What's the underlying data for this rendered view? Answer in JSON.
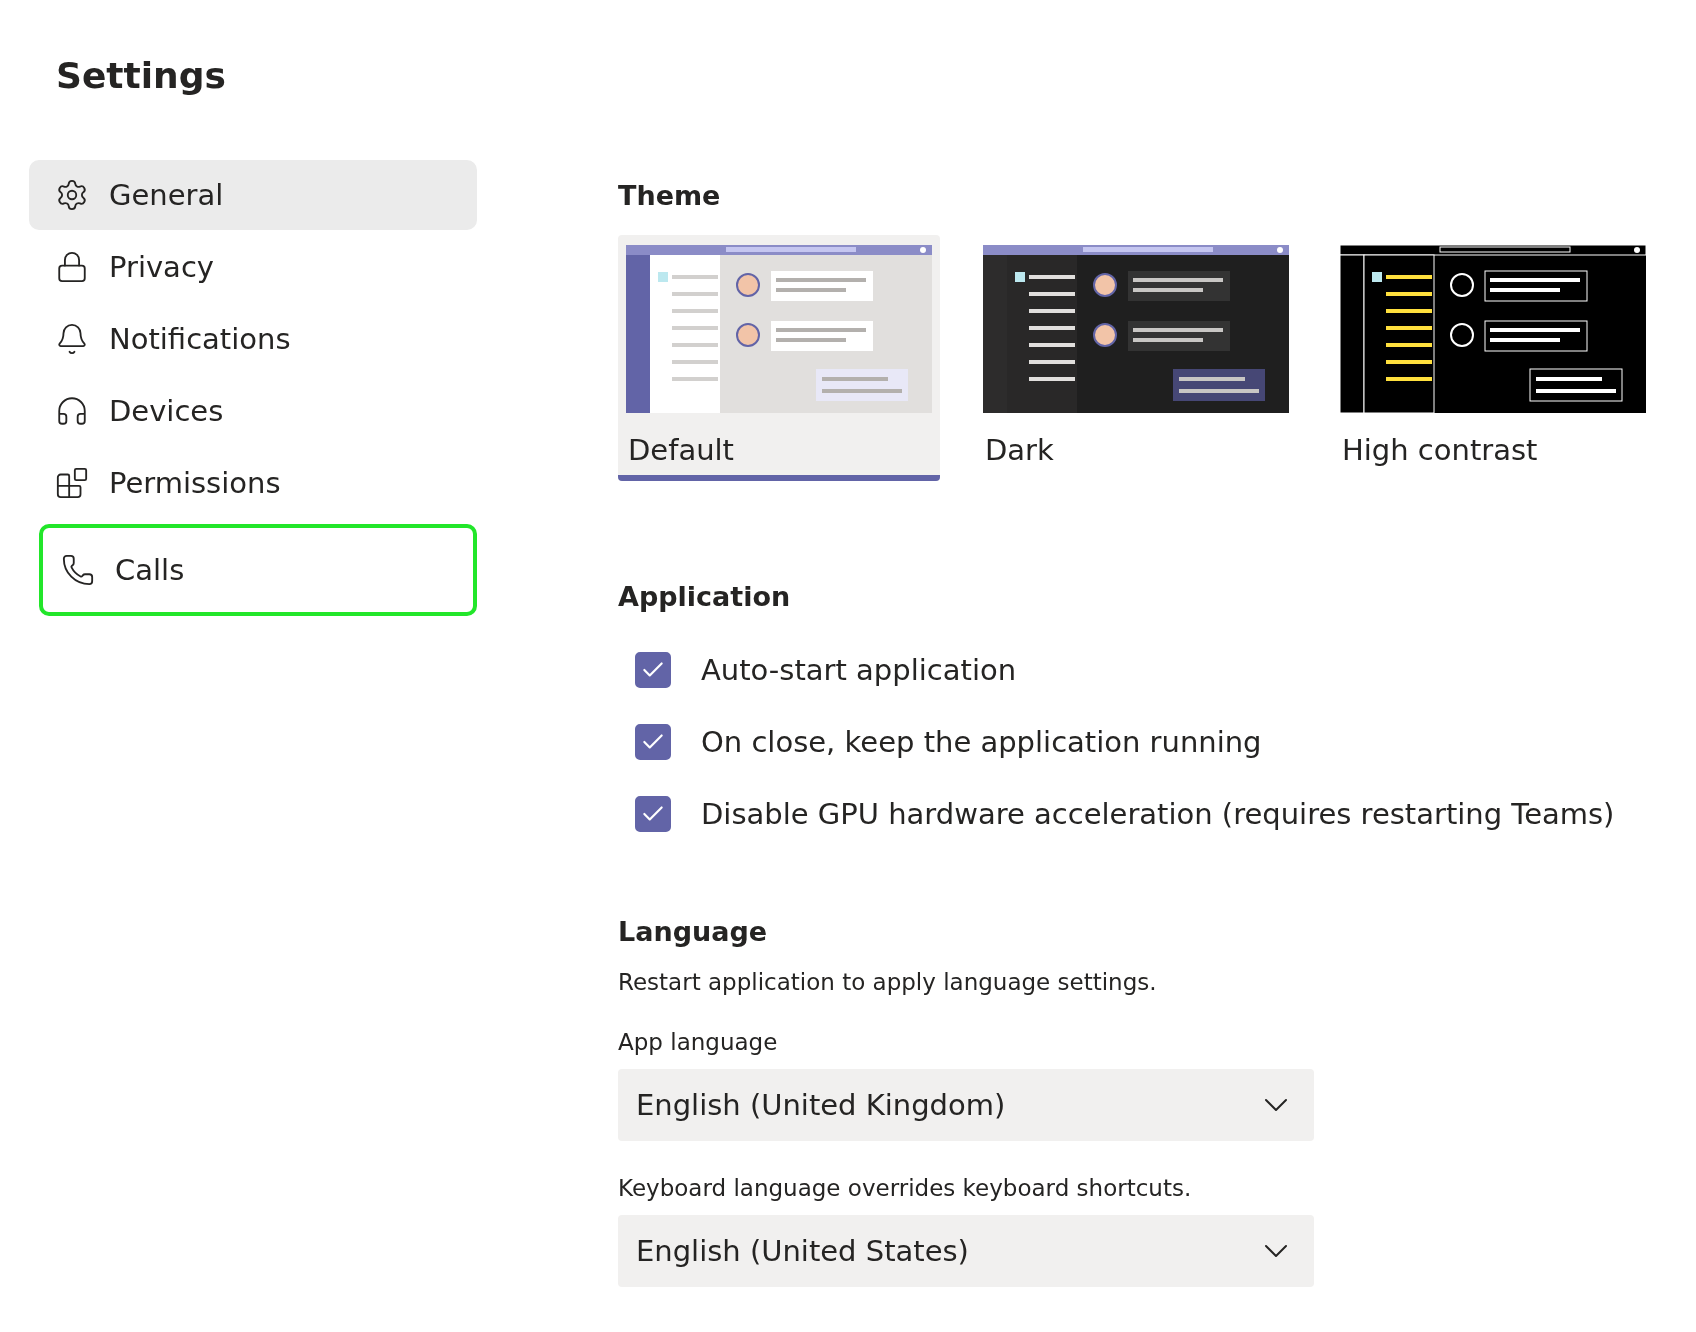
{
  "title": "Settings",
  "sidebar": {
    "items": [
      {
        "label": "General",
        "selected": true,
        "highlighted": false
      },
      {
        "label": "Privacy",
        "selected": false,
        "highlighted": false
      },
      {
        "label": "Notifications",
        "selected": false,
        "highlighted": false
      },
      {
        "label": "Devices",
        "selected": false,
        "highlighted": false
      },
      {
        "label": "Permissions",
        "selected": false,
        "highlighted": false
      },
      {
        "label": "Calls",
        "selected": false,
        "highlighted": true
      }
    ]
  },
  "theme": {
    "heading": "Theme",
    "options": [
      {
        "label": "Default",
        "kind": "default",
        "selected": true
      },
      {
        "label": "Dark",
        "kind": "dark",
        "selected": false
      },
      {
        "label": "High contrast",
        "kind": "contrast",
        "selected": false
      }
    ]
  },
  "application": {
    "heading": "Application",
    "options": [
      {
        "label": "Auto-start application",
        "checked": true
      },
      {
        "label": "On close, keep the application running",
        "checked": true
      },
      {
        "label": "Disable GPU hardware acceleration (requires restarting Teams)",
        "checked": true
      }
    ]
  },
  "language": {
    "heading": "Language",
    "note": "Restart application to apply language settings.",
    "fields": [
      {
        "label": "App language",
        "value": "English (United Kingdom)"
      },
      {
        "label": "Keyboard language overrides keyboard shortcuts.",
        "value": "English (United States)"
      }
    ]
  }
}
